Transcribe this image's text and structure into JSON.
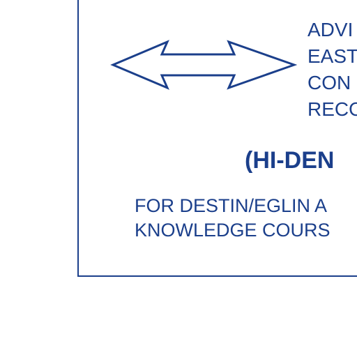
{
  "advisory_lines": [
    "ADVI",
    "EAST",
    "CON",
    "RECO"
  ],
  "density_label": "(HI-DEN",
  "note_lines": [
    "FOR DESTIN/EGLIN A",
    "KNOWLEDGE COURS"
  ],
  "colors": {
    "ink": "#1b3f8b",
    "background": "#ffffff"
  },
  "icons": {
    "arrow": "double-headed-arrow-icon"
  }
}
